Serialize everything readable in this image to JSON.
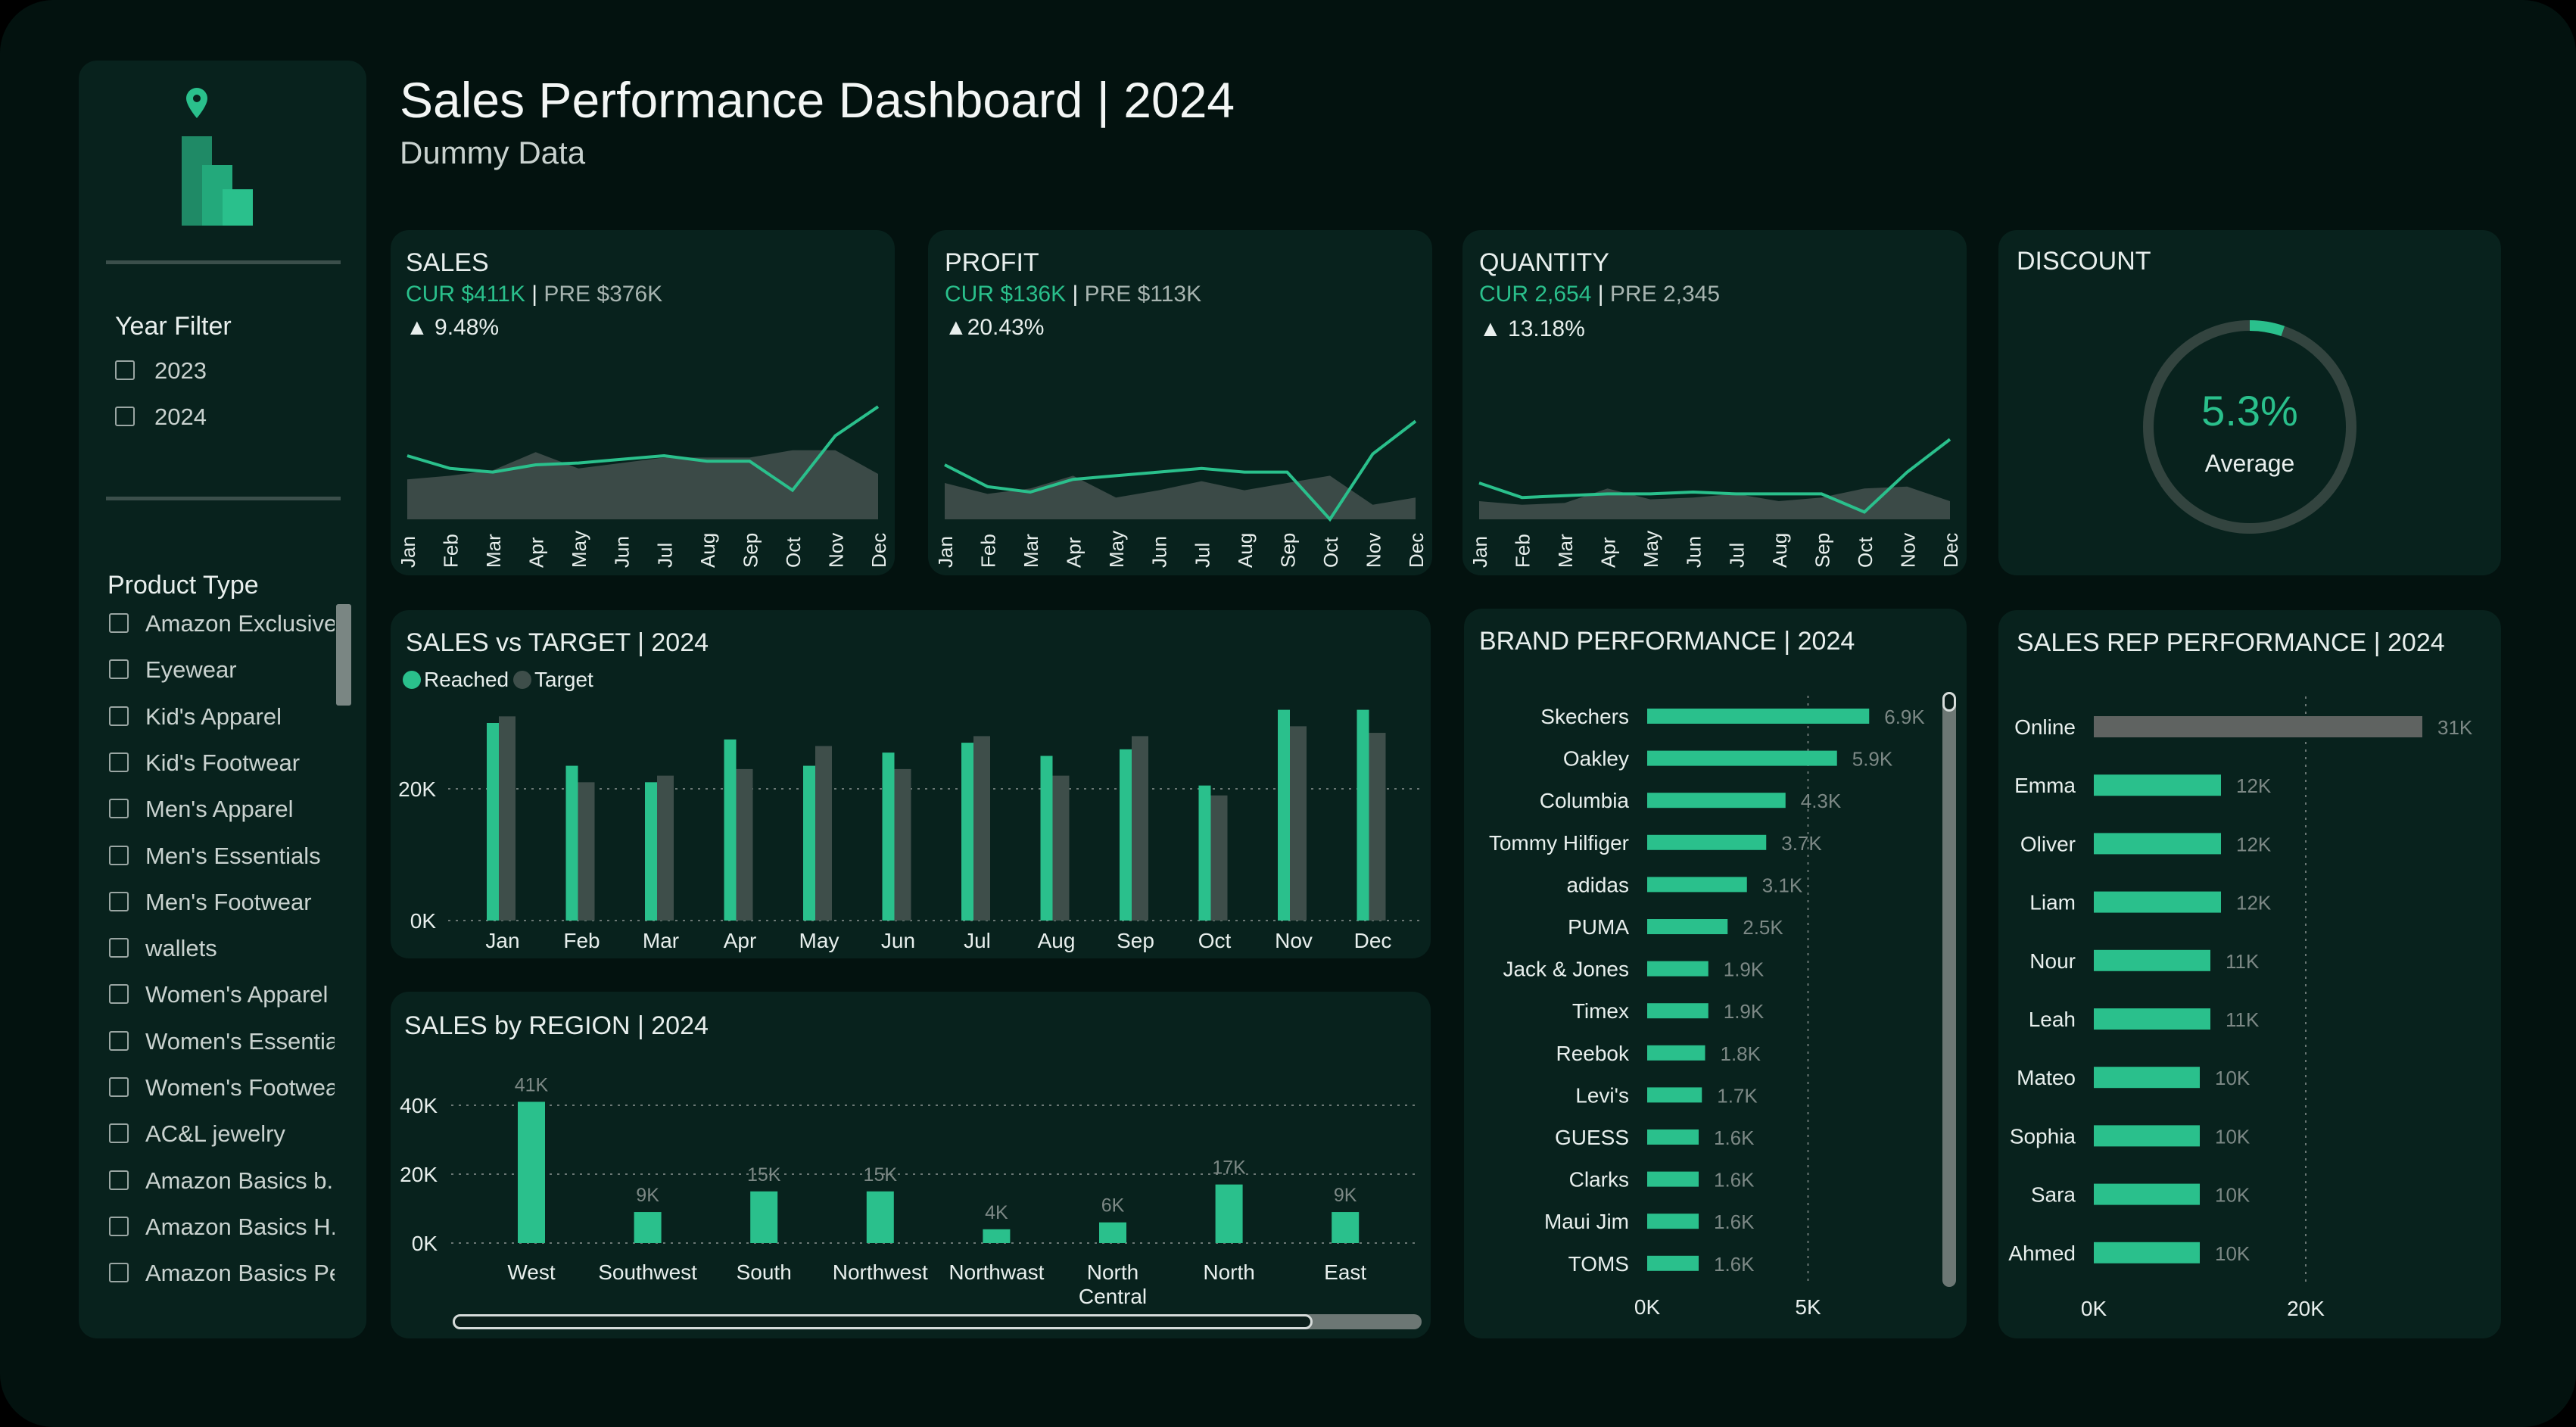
{
  "header": {
    "title": "Sales Performance Dashboard | 2024",
    "subtitle": "Dummy Data"
  },
  "sidebar": {
    "year_filter": {
      "label": "Year Filter",
      "options": [
        "2023",
        "2024"
      ]
    },
    "product_type": {
      "label": "Product Type",
      "options": [
        "Amazon Exclusive...",
        "Eyewear",
        "Kid's Apparel",
        "Kid's Footwear",
        "Men's Apparel",
        "Men's Essentials",
        "Men's Footwear",
        "wallets",
        "Women's Apparel",
        "Women's Essentials",
        "Women's Footwear",
        "AC&L jewelry",
        "Amazon Basics b...",
        "Amazon Basics H...",
        "Amazon Basics Pe..."
      ]
    }
  },
  "colors": {
    "accent": "#2ac08c",
    "target": "#3e4e4a",
    "area": "#3b4a47",
    "panel": "#08221d",
    "background": "#03120f"
  },
  "icons": {
    "logo": "bar-chart-location-logo",
    "checkbox": "checkbox-icon",
    "scrollbar": "scrollbar"
  },
  "kpis": {
    "sales": {
      "title": "SALES",
      "cur_label": "CUR",
      "cur_value": "$411K",
      "pre_label": "PRE",
      "pre_value": "$376K",
      "change": "▲ 9.48%",
      "months": [
        "Jan",
        "Feb",
        "Mar",
        "Apr",
        "May",
        "Jun",
        "Jul",
        "Aug",
        "Sep",
        "Oct",
        "Nov",
        "Dec"
      ],
      "current": [
        35,
        28,
        26,
        30,
        31,
        33,
        35,
        32,
        32,
        16,
        46,
        62
      ],
      "previous": [
        22,
        24,
        27,
        37,
        28,
        31,
        34,
        34,
        34,
        38,
        38,
        25
      ]
    },
    "profit": {
      "title": "PROFIT",
      "cur_label": "CUR",
      "cur_value": "$136K",
      "pre_label": "PRE",
      "pre_value": "$113K",
      "change": "▲20.43%",
      "months": [
        "Jan",
        "Feb",
        "Mar",
        "Apr",
        "May",
        "Jun",
        "Jul",
        "Aug",
        "Sep",
        "Oct",
        "Nov",
        "Dec"
      ],
      "current": [
        30,
        18,
        15,
        22,
        24,
        26,
        28,
        26,
        26,
        0,
        36,
        54
      ],
      "previous": [
        20,
        14,
        17,
        24,
        12,
        16,
        21,
        16,
        20,
        24,
        8,
        12
      ]
    },
    "quantity": {
      "title": "QUANTITY",
      "cur_label": "CUR",
      "cur_value": "2,654",
      "pre_label": "PRE",
      "pre_value": "2,345",
      "change": "▲ 13.18%",
      "months": [
        "Jan",
        "Feb",
        "Mar",
        "Apr",
        "May",
        "Jun",
        "Jul",
        "Aug",
        "Sep",
        "Oct",
        "Nov",
        "Dec"
      ],
      "current": [
        20,
        12,
        13,
        14,
        14,
        15,
        14,
        14,
        14,
        4,
        26,
        44
      ],
      "previous": [
        10,
        8,
        9,
        17,
        11,
        12,
        14,
        10,
        12,
        17,
        18,
        10
      ]
    },
    "discount": {
      "title": "DISCOUNT",
      "value": "5.3%",
      "label": "Average",
      "fraction": 0.053
    }
  },
  "chart_data": [
    {
      "type": "bar",
      "title": "SALES vs TARGET | 2024",
      "categories": [
        "Jan",
        "Feb",
        "Mar",
        "Apr",
        "May",
        "Jun",
        "Jul",
        "Aug",
        "Sep",
        "Oct",
        "Nov",
        "Dec"
      ],
      "series": [
        {
          "name": "Reached",
          "values": [
            30,
            23.5,
            21,
            27.5,
            23.5,
            25.5,
            27,
            25,
            26,
            20.5,
            32,
            32
          ]
        },
        {
          "name": "Target",
          "values": [
            31,
            21,
            22,
            23,
            26.5,
            23,
            28,
            22,
            28,
            19,
            29.5,
            28.5
          ]
        }
      ],
      "yticks": [
        "0K",
        "20K"
      ],
      "ylim": [
        0,
        40
      ],
      "legend": "top-left"
    },
    {
      "type": "bar",
      "title": "SALES by REGION | 2024",
      "categories": [
        "West",
        "Southwest",
        "South",
        "Northwest",
        "Northwast",
        "North Central",
        "North",
        "East"
      ],
      "values": [
        41,
        9,
        15,
        15,
        4,
        6,
        17,
        9
      ],
      "labels": [
        "41K",
        "9K",
        "15K",
        "15K",
        "4K",
        "6K",
        "17K",
        "9K"
      ],
      "yticks": [
        "0K",
        "20K",
        "40K"
      ],
      "ylim": [
        0,
        45
      ]
    },
    {
      "type": "bar",
      "title": "BRAND PERFORMANCE | 2024",
      "categories": [
        "Skechers",
        "Oakley",
        "Columbia",
        "Tommy Hilfiger",
        "adidas",
        "PUMA",
        "Jack & Jones",
        "Timex",
        "Reebok",
        "Levi's",
        "GUESS",
        "Clarks",
        "Maui Jim",
        "TOMS"
      ],
      "values": [
        6.9,
        5.9,
        4.3,
        3.7,
        3.1,
        2.5,
        1.9,
        1.9,
        1.8,
        1.7,
        1.6,
        1.6,
        1.6,
        1.6
      ],
      "labels": [
        "6.9K",
        "5.9K",
        "4.3K",
        "3.7K",
        "3.1K",
        "2.5K",
        "1.9K",
        "1.9K",
        "1.8K",
        "1.7K",
        "1.6K",
        "1.6K",
        "1.6K",
        "1.6K"
      ],
      "xticks": [
        "0K",
        "5K"
      ],
      "xlim": [
        0,
        8.5
      ]
    },
    {
      "type": "bar",
      "title": "SALES REP PERFORMANCE | 2024",
      "categories": [
        "Online",
        "Emma",
        "Oliver",
        "Liam",
        "Nour",
        "Leah",
        "Mateo",
        "Sophia",
        "Sara",
        "Ahmed"
      ],
      "values": [
        31,
        12,
        12,
        12,
        11,
        11,
        10,
        10,
        10,
        10
      ],
      "labels": [
        "31K",
        "12K",
        "12K",
        "12K",
        "11K",
        "11K",
        "10K",
        "10K",
        "10K",
        "10K"
      ],
      "xticks": [
        "0K",
        "20K"
      ],
      "xlim": [
        0,
        38
      ]
    }
  ]
}
